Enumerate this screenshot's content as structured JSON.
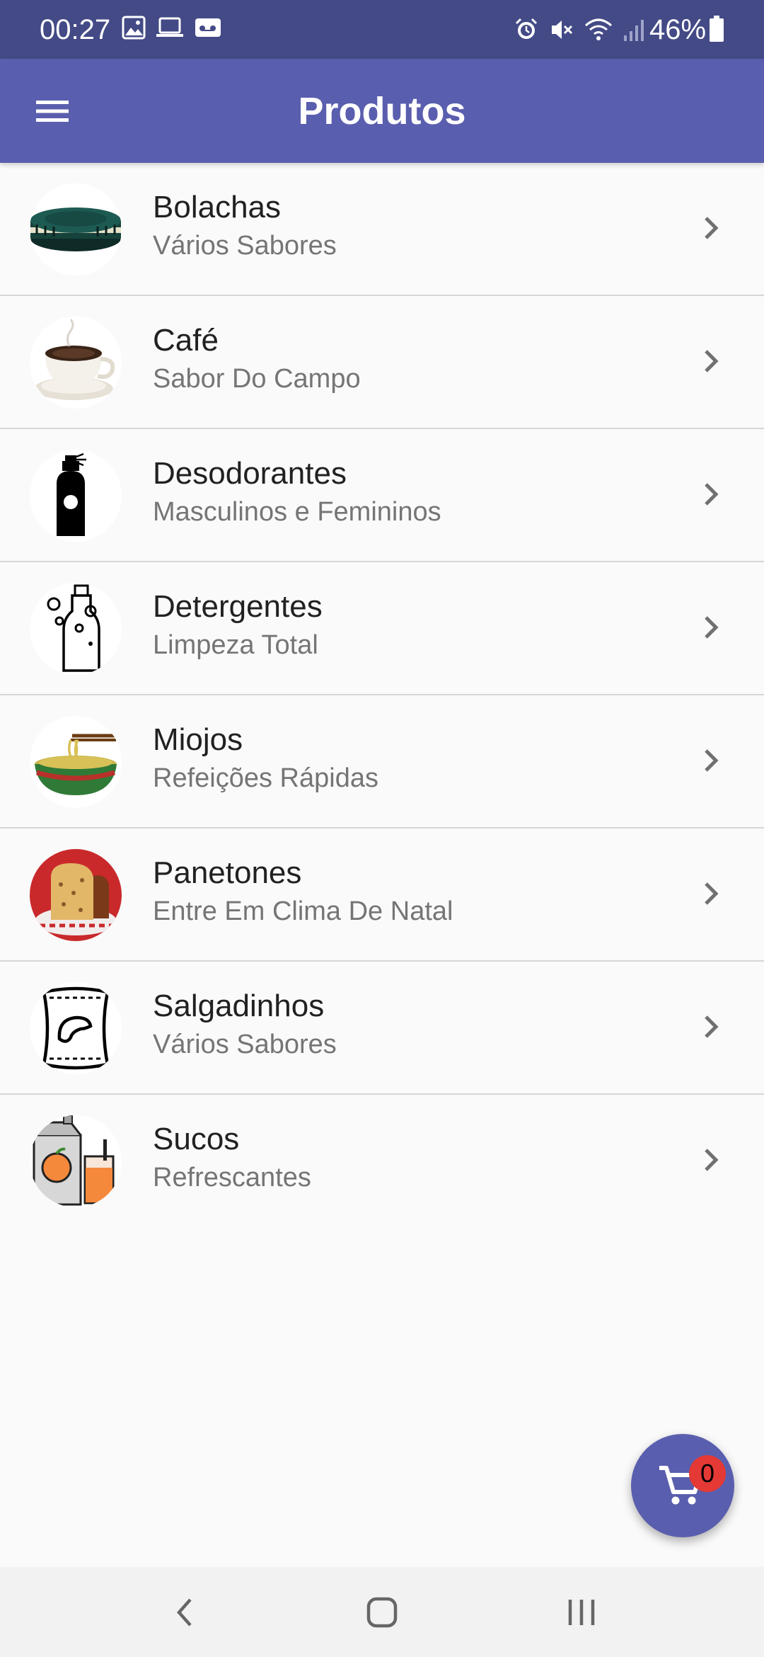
{
  "status_bar": {
    "time": "00:27",
    "battery": "46%",
    "left_icons": [
      "image-icon",
      "laptop-icon",
      "voicemail-icon"
    ],
    "right_icons": [
      "alarm-icon",
      "mute-icon",
      "wifi-icon",
      "signal-icon",
      "battery-icon"
    ]
  },
  "app_bar": {
    "title": "Produtos",
    "menu_icon": "menu-icon"
  },
  "products": [
    {
      "name": "Bolachas",
      "subtitle": "Vários Sabores",
      "icon": "biscuit-icon"
    },
    {
      "name": "Café",
      "subtitle": "Sabor Do Campo",
      "icon": "coffee-icon"
    },
    {
      "name": "Desodorantes",
      "subtitle": "Masculinos e Femininos",
      "icon": "spray-icon"
    },
    {
      "name": "Detergentes",
      "subtitle": "Limpeza Total",
      "icon": "detergent-icon"
    },
    {
      "name": "Miojos",
      "subtitle": "Refeições Rápidas",
      "icon": "noodles-icon"
    },
    {
      "name": "Panetones",
      "subtitle": "Entre Em Clima De Natal",
      "icon": "panettone-icon"
    },
    {
      "name": "Salgadinhos",
      "subtitle": "Vários Sabores",
      "icon": "chips-icon"
    },
    {
      "name": "Sucos",
      "subtitle": "Refrescantes",
      "icon": "juice-icon"
    }
  ],
  "cart": {
    "count": "0",
    "icon": "cart-icon"
  },
  "nav_bar": {
    "icons": [
      "back-icon",
      "home-icon",
      "recents-icon"
    ]
  },
  "colors": {
    "status_bar": "#434a86",
    "app_bar": "#5a5eae",
    "badge": "#e53935"
  }
}
